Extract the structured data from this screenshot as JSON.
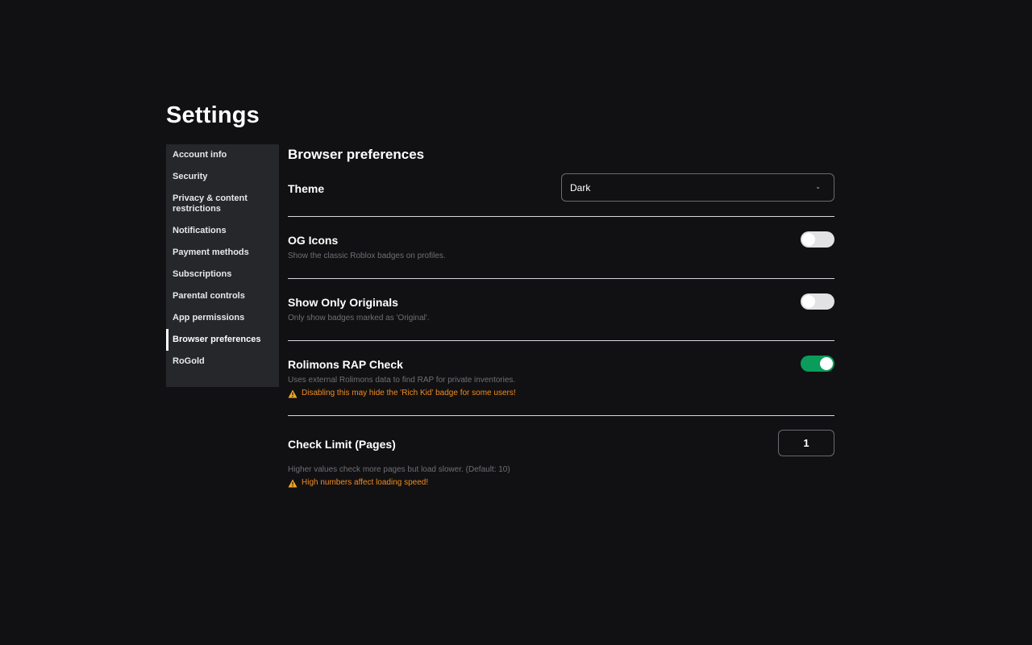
{
  "page": {
    "title": "Settings"
  },
  "sidebar": {
    "items": [
      {
        "label": "Account info"
      },
      {
        "label": "Security"
      },
      {
        "label": "Privacy & content restrictions"
      },
      {
        "label": "Notifications"
      },
      {
        "label": "Payment methods"
      },
      {
        "label": "Subscriptions"
      },
      {
        "label": "Parental controls"
      },
      {
        "label": "App permissions"
      },
      {
        "label": "Browser preferences",
        "active": true
      },
      {
        "label": "RoGold"
      }
    ]
  },
  "content": {
    "section_title": "Browser preferences",
    "theme": {
      "label": "Theme",
      "value": "Dark",
      "chevron": "⌄"
    },
    "og_icons": {
      "label": "OG Icons",
      "description": "Show the classic Roblox badges on profiles.",
      "enabled": false
    },
    "show_only_originals": {
      "label": "Show Only Originals",
      "description": "Only show badges marked as 'Original'.",
      "enabled": false
    },
    "rolimons_rap_check": {
      "label": "Rolimons RAP Check",
      "description": "Uses external Rolimons data to find RAP for private inventories.",
      "warning": "Disabling this may hide the 'Rich Kid' badge for some users!",
      "enabled": true
    },
    "check_limit": {
      "label": "Check Limit (Pages)",
      "value": "1",
      "description": "Higher values check more pages but load slower. (Default: 10)",
      "warning": "High numbers affect loading speed!"
    }
  },
  "colors": {
    "background": "#111113",
    "sidebar": "#26272b",
    "toggle_on": "#0a9c5b",
    "toggle_off": "#e2e2e4",
    "warning": "#f28a1f"
  },
  "icons": {
    "warning": "warning-triangle-icon"
  }
}
